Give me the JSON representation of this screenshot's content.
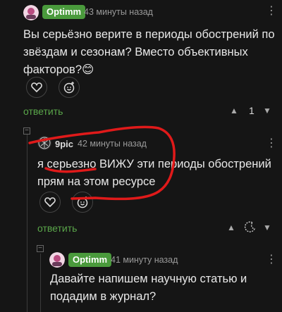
{
  "comments": [
    {
      "author": "Optimm",
      "time": "43 минуты назад",
      "text_line1": "Вы серьёзно верите в периоды обострений по",
      "text_line2": "звёздам и сезонам? Вместо объективных",
      "text_line3": "факторов?😊",
      "reply_label": "ответить",
      "rating": "1"
    },
    {
      "author": "9pic",
      "time": "42 минуты назад",
      "text_line1": "я серьезно ВИЖУ эти периоды обострений",
      "text_line2": "прям на этом ресурсе",
      "reply_label": "ответить"
    },
    {
      "author": "Optimm",
      "time": "41 минуту назад",
      "text_line1": "Давайте напишем научную статью и",
      "text_line2": "подадим в журнал?"
    }
  ],
  "icons": {
    "like": "heart-icon",
    "emoji": "emoji-add-icon",
    "upvote": "triangle-up-icon",
    "downvote": "triangle-down-icon",
    "menu": "kebab-icon",
    "moon": "moon-icon"
  },
  "colors": {
    "background": "#151515",
    "accent": "#5aa64a",
    "badge": "#4a9a3c",
    "annotation": "#e01a1a"
  }
}
